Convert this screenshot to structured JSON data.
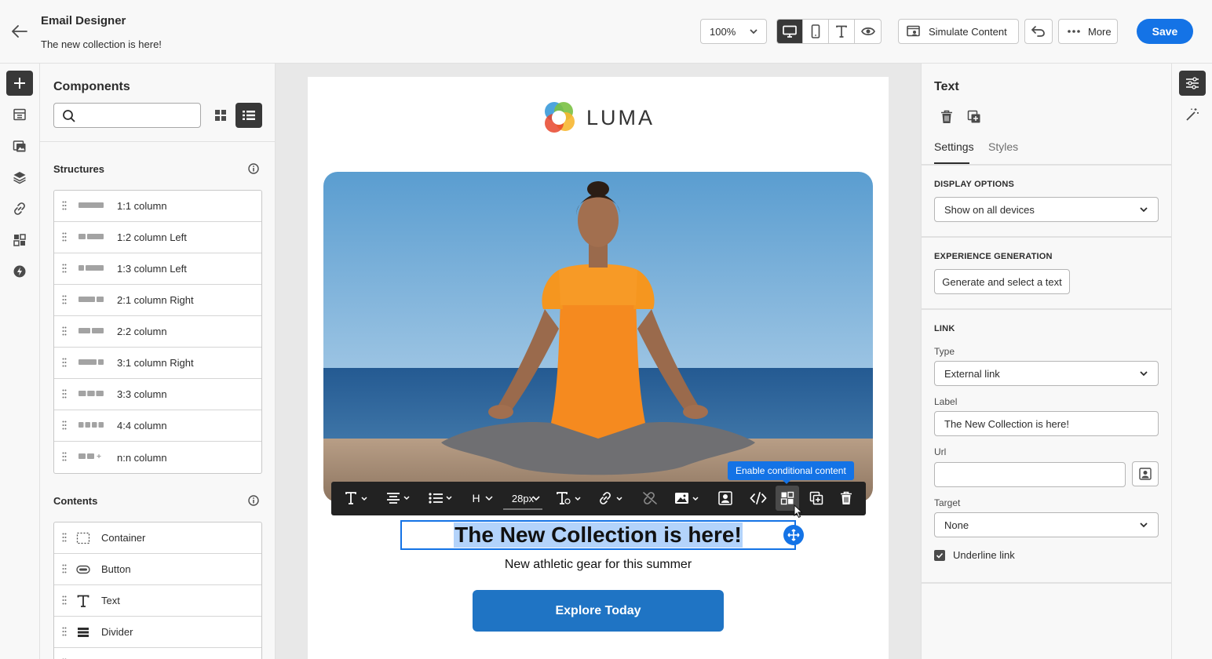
{
  "header": {
    "app_title": "Email Designer",
    "subject": "The new collection is here!",
    "zoom": "100%",
    "simulate_label": "Simulate Content",
    "more_label": "More",
    "save_label": "Save",
    "accent_color": "#1473e6"
  },
  "components": {
    "title": "Components",
    "search_placeholder": "",
    "structures_title": "Structures",
    "structures": [
      "1:1 column",
      "1:2 column Left",
      "1:3 column Left",
      "2:1 column Right",
      "2:2 column",
      "3:1 column Right",
      "3:3 column",
      "4:4 column",
      "n:n column"
    ],
    "contents_title": "Contents",
    "contents": [
      "Container",
      "Button",
      "Text",
      "Divider"
    ]
  },
  "email": {
    "brand": "LUMA",
    "headline": "The New Collection is here!",
    "subline": "New athletic gear for this summer",
    "cta": "Explore Today"
  },
  "toolbar": {
    "heading": "H",
    "font_size": "28px",
    "tooltip": "Enable conditional content"
  },
  "panel": {
    "title": "Text",
    "tab_settings": "Settings",
    "tab_styles": "Styles",
    "display_options_title": "DISPLAY OPTIONS",
    "display_options_value": "Show on all devices",
    "experience_title": "EXPERIENCE GENERATION",
    "generate_label": "Generate and select a text",
    "link_title": "LINK",
    "type_label": "Type",
    "type_value": "External link",
    "label_label": "Label",
    "label_value": "The New Collection is here!",
    "url_label": "Url",
    "url_value": "",
    "target_label": "Target",
    "target_value": "None",
    "underline_label": "Underline link",
    "underline_checked": true
  }
}
